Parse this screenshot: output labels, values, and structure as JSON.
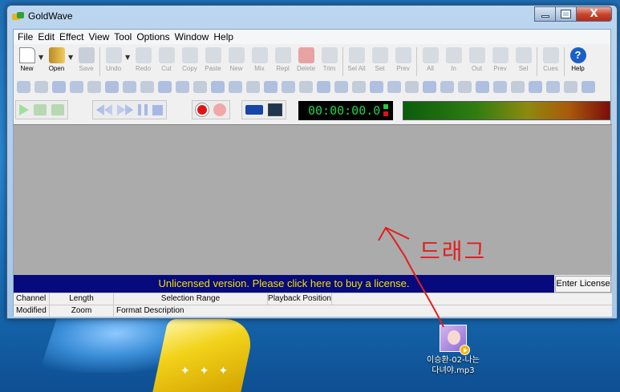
{
  "window": {
    "title": "GoldWave",
    "controls": {
      "minimize": "_",
      "maximize": "□",
      "close": "X"
    }
  },
  "menu": [
    "File",
    "Edit",
    "Effect",
    "View",
    "Tool",
    "Options",
    "Window",
    "Help"
  ],
  "toolbar": [
    {
      "label": "New",
      "icon": "new-file-icon",
      "enabled": true
    },
    {
      "label": "Open",
      "icon": "open-folder-icon",
      "enabled": true
    },
    {
      "label": "Save",
      "icon": "save-icon",
      "enabled": false
    },
    {
      "label": "Undo",
      "icon": "undo-icon",
      "enabled": false
    },
    {
      "label": "Redo",
      "icon": "redo-icon",
      "enabled": false
    },
    {
      "label": "Cut",
      "icon": "cut-icon",
      "enabled": false
    },
    {
      "label": "Copy",
      "icon": "copy-icon",
      "enabled": false
    },
    {
      "label": "Paste",
      "icon": "paste-icon",
      "enabled": false
    },
    {
      "label": "New",
      "icon": "paste-new-icon",
      "enabled": false
    },
    {
      "label": "Mix",
      "icon": "mix-icon",
      "enabled": false
    },
    {
      "label": "Repl",
      "icon": "replace-icon",
      "enabled": false
    },
    {
      "label": "Delete",
      "icon": "delete-icon",
      "enabled": false
    },
    {
      "label": "Trim",
      "icon": "trim-icon",
      "enabled": false
    },
    {
      "label": "Sel All",
      "icon": "select-all-icon",
      "enabled": false
    },
    {
      "label": "Set",
      "icon": "set-icon",
      "enabled": false
    },
    {
      "label": "Prev",
      "icon": "previous-icon",
      "enabled": false
    },
    {
      "label": "All",
      "icon": "zoom-all-icon",
      "enabled": false
    },
    {
      "label": "In",
      "icon": "zoom-in-icon",
      "enabled": false
    },
    {
      "label": "Out",
      "icon": "zoom-out-icon",
      "enabled": false
    },
    {
      "label": "Prev",
      "icon": "zoom-previous-icon",
      "enabled": false
    },
    {
      "label": "Sel",
      "icon": "zoom-selection-icon",
      "enabled": false
    },
    {
      "label": "Cues",
      "icon": "cues-icon",
      "enabled": false
    },
    {
      "label": "Help",
      "icon": "help-icon",
      "enabled": true
    }
  ],
  "transport": {
    "time": "00:00:00.0"
  },
  "license": {
    "message": "Unlicensed version. Please click here to buy a license.",
    "button": "Enter License"
  },
  "status": {
    "row1": [
      "Channel",
      "Length",
      "Selection Range",
      "Playback Position",
      ""
    ],
    "row2": [
      "Modified",
      "Zoom",
      "Format Description"
    ]
  },
  "desktop": {
    "file_name": "이승환-02-나는 다녀야.mp3"
  },
  "annotation": {
    "text": "드래그",
    "color": "#e02020"
  }
}
